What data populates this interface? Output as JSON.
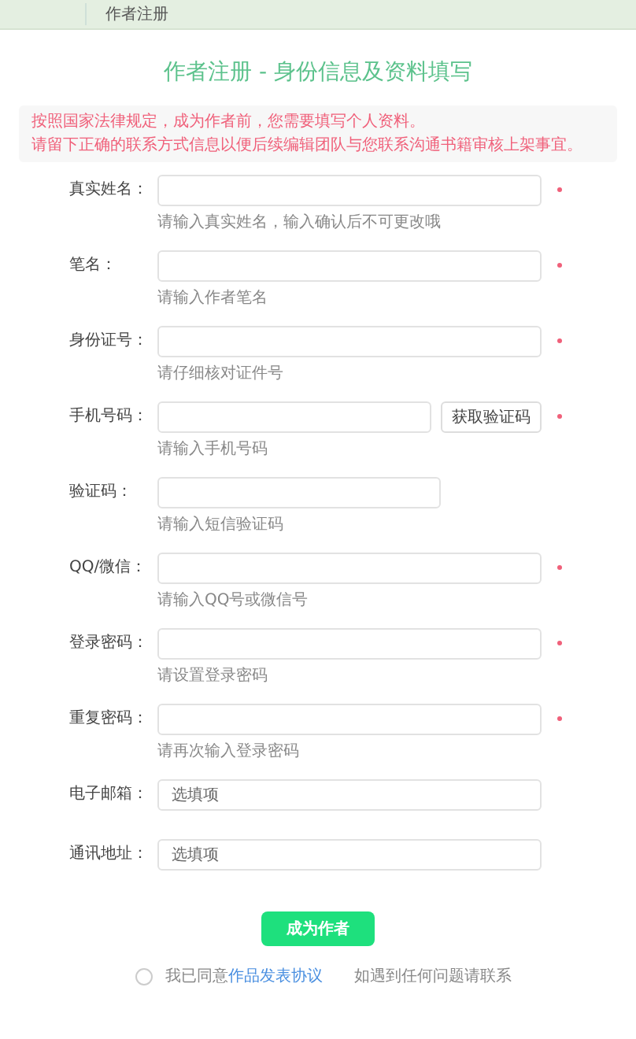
{
  "header": {
    "title": "作者注册"
  },
  "page_title": "作者注册 - 身份信息及资料填写",
  "notice": [
    "按照国家法律规定，成为作者前，您需要填写个人资料。",
    "请留下正确的联系方式信息以便后续编辑团队与您联系沟通书籍审核上架事宜。"
  ],
  "fields": [
    {
      "kind": "text",
      "label": "真实姓名：",
      "hint": "请输入真实姓名，输入确认后不可更改哦",
      "required": true
    },
    {
      "kind": "text",
      "label": "笔名：",
      "hint": "请输入作者笔名",
      "required": true
    },
    {
      "kind": "text",
      "label": "身份证号：",
      "hint": "请仔细核对证件号",
      "required": true
    },
    {
      "kind": "with_button",
      "label": "手机号码：",
      "hint": "请输入手机号码",
      "button": "获取验证码",
      "required": true
    },
    {
      "kind": "short",
      "label": "验证码：",
      "hint": "请输入短信验证码",
      "required": false
    },
    {
      "kind": "text",
      "label": "QQ/微信：",
      "hint": "请输入QQ号或微信号",
      "required": true
    },
    {
      "kind": "text",
      "label": "登录密码：",
      "hint": "请设置登录密码",
      "required": true
    },
    {
      "kind": "text",
      "label": "重复密码：",
      "hint": "请再次输入登录密码",
      "required": true
    },
    {
      "kind": "text",
      "label": "电子邮箱：",
      "placeholder": "选填项",
      "required": false
    },
    {
      "kind": "text",
      "label": "通讯地址：",
      "placeholder": "选填项",
      "required": false
    }
  ],
  "submit_button": "成为作者",
  "agreement": {
    "checked": false,
    "text": "我已同意",
    "link": "作品发表协议"
  },
  "help_text": "如遇到任何问题请联系"
}
